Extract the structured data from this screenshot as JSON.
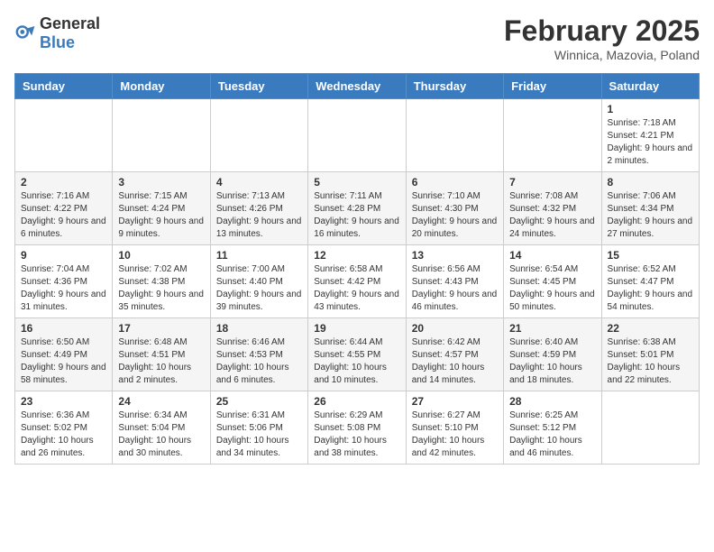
{
  "logo": {
    "general": "General",
    "blue": "Blue"
  },
  "title": "February 2025",
  "subtitle": "Winnica, Mazovia, Poland",
  "days_of_week": [
    "Sunday",
    "Monday",
    "Tuesday",
    "Wednesday",
    "Thursday",
    "Friday",
    "Saturday"
  ],
  "weeks": [
    [
      {
        "day": "",
        "info": ""
      },
      {
        "day": "",
        "info": ""
      },
      {
        "day": "",
        "info": ""
      },
      {
        "day": "",
        "info": ""
      },
      {
        "day": "",
        "info": ""
      },
      {
        "day": "",
        "info": ""
      },
      {
        "day": "1",
        "info": "Sunrise: 7:18 AM\nSunset: 4:21 PM\nDaylight: 9 hours and 2 minutes."
      }
    ],
    [
      {
        "day": "2",
        "info": "Sunrise: 7:16 AM\nSunset: 4:22 PM\nDaylight: 9 hours and 6 minutes."
      },
      {
        "day": "3",
        "info": "Sunrise: 7:15 AM\nSunset: 4:24 PM\nDaylight: 9 hours and 9 minutes."
      },
      {
        "day": "4",
        "info": "Sunrise: 7:13 AM\nSunset: 4:26 PM\nDaylight: 9 hours and 13 minutes."
      },
      {
        "day": "5",
        "info": "Sunrise: 7:11 AM\nSunset: 4:28 PM\nDaylight: 9 hours and 16 minutes."
      },
      {
        "day": "6",
        "info": "Sunrise: 7:10 AM\nSunset: 4:30 PM\nDaylight: 9 hours and 20 minutes."
      },
      {
        "day": "7",
        "info": "Sunrise: 7:08 AM\nSunset: 4:32 PM\nDaylight: 9 hours and 24 minutes."
      },
      {
        "day": "8",
        "info": "Sunrise: 7:06 AM\nSunset: 4:34 PM\nDaylight: 9 hours and 27 minutes."
      }
    ],
    [
      {
        "day": "9",
        "info": "Sunrise: 7:04 AM\nSunset: 4:36 PM\nDaylight: 9 hours and 31 minutes."
      },
      {
        "day": "10",
        "info": "Sunrise: 7:02 AM\nSunset: 4:38 PM\nDaylight: 9 hours and 35 minutes."
      },
      {
        "day": "11",
        "info": "Sunrise: 7:00 AM\nSunset: 4:40 PM\nDaylight: 9 hours and 39 minutes."
      },
      {
        "day": "12",
        "info": "Sunrise: 6:58 AM\nSunset: 4:42 PM\nDaylight: 9 hours and 43 minutes."
      },
      {
        "day": "13",
        "info": "Sunrise: 6:56 AM\nSunset: 4:43 PM\nDaylight: 9 hours and 46 minutes."
      },
      {
        "day": "14",
        "info": "Sunrise: 6:54 AM\nSunset: 4:45 PM\nDaylight: 9 hours and 50 minutes."
      },
      {
        "day": "15",
        "info": "Sunrise: 6:52 AM\nSunset: 4:47 PM\nDaylight: 9 hours and 54 minutes."
      }
    ],
    [
      {
        "day": "16",
        "info": "Sunrise: 6:50 AM\nSunset: 4:49 PM\nDaylight: 9 hours and 58 minutes."
      },
      {
        "day": "17",
        "info": "Sunrise: 6:48 AM\nSunset: 4:51 PM\nDaylight: 10 hours and 2 minutes."
      },
      {
        "day": "18",
        "info": "Sunrise: 6:46 AM\nSunset: 4:53 PM\nDaylight: 10 hours and 6 minutes."
      },
      {
        "day": "19",
        "info": "Sunrise: 6:44 AM\nSunset: 4:55 PM\nDaylight: 10 hours and 10 minutes."
      },
      {
        "day": "20",
        "info": "Sunrise: 6:42 AM\nSunset: 4:57 PM\nDaylight: 10 hours and 14 minutes."
      },
      {
        "day": "21",
        "info": "Sunrise: 6:40 AM\nSunset: 4:59 PM\nDaylight: 10 hours and 18 minutes."
      },
      {
        "day": "22",
        "info": "Sunrise: 6:38 AM\nSunset: 5:01 PM\nDaylight: 10 hours and 22 minutes."
      }
    ],
    [
      {
        "day": "23",
        "info": "Sunrise: 6:36 AM\nSunset: 5:02 PM\nDaylight: 10 hours and 26 minutes."
      },
      {
        "day": "24",
        "info": "Sunrise: 6:34 AM\nSunset: 5:04 PM\nDaylight: 10 hours and 30 minutes."
      },
      {
        "day": "25",
        "info": "Sunrise: 6:31 AM\nSunset: 5:06 PM\nDaylight: 10 hours and 34 minutes."
      },
      {
        "day": "26",
        "info": "Sunrise: 6:29 AM\nSunset: 5:08 PM\nDaylight: 10 hours and 38 minutes."
      },
      {
        "day": "27",
        "info": "Sunrise: 6:27 AM\nSunset: 5:10 PM\nDaylight: 10 hours and 42 minutes."
      },
      {
        "day": "28",
        "info": "Sunrise: 6:25 AM\nSunset: 5:12 PM\nDaylight: 10 hours and 46 minutes."
      },
      {
        "day": "",
        "info": ""
      }
    ]
  ]
}
